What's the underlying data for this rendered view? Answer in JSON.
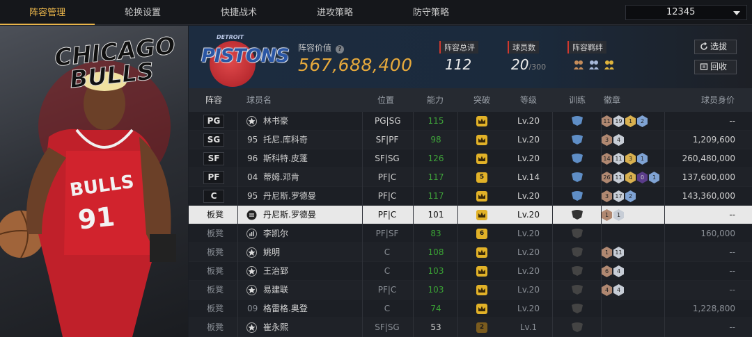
{
  "tabs": [
    {
      "label": "阵容管理",
      "active": true
    },
    {
      "label": "轮换设置",
      "active": false
    },
    {
      "label": "快捷战术",
      "active": false
    },
    {
      "label": "进攻策略",
      "active": false
    },
    {
      "label": "防守策略",
      "active": false
    }
  ],
  "account": {
    "value": "12345"
  },
  "hero": {
    "team_text_1": "CHICAGO",
    "team_text_2": "BULLS",
    "jersey_text": "BULLS",
    "jersey_number": "91"
  },
  "team": {
    "logo_text": "PISTONS",
    "logo_subtext": "DETROIT"
  },
  "stats": {
    "lineup_value_label": "阵容价值",
    "lineup_value": "567,688,400",
    "rating_label": "阵容总评",
    "rating": "112",
    "players_label": "球员数",
    "players": "20",
    "players_max": "/300",
    "chemistry_label": "阵容羁绊"
  },
  "buttons": {
    "select_label": "选拔",
    "recycle_label": "回收"
  },
  "columns": {
    "lineup": "阵容",
    "name": "球员名",
    "position": "位置",
    "ability": "能力",
    "breakthrough": "突破",
    "level": "等级",
    "training": "训练",
    "badges": "徽章",
    "value": "球员身价"
  },
  "bench_label": "板凳",
  "rows": [
    {
      "slot": "PG",
      "icon": "star",
      "num": "",
      "name": "林书豪",
      "pos": "PG|SG",
      "ability": "115",
      "break": "",
      "level": "Lv.20",
      "badges": [
        [
          "b-br",
          "11"
        ],
        [
          "b-si",
          "19"
        ],
        [
          "b-go",
          "1"
        ],
        [
          "b-bl",
          "2"
        ]
      ],
      "value": "--"
    },
    {
      "slot": "SG",
      "icon": "",
      "num": "95",
      "name": "托尼.库科奇",
      "pos": "SF|PF",
      "ability": "98",
      "break": "",
      "level": "Lv.20",
      "badges": [
        [
          "b-br",
          "3"
        ],
        [
          "b-si",
          "4"
        ]
      ],
      "value": "1,209,600"
    },
    {
      "slot": "SF",
      "icon": "",
      "num": "96",
      "name": "斯科特.皮蓬",
      "pos": "SF|SG",
      "ability": "126",
      "break": "",
      "level": "Lv.20",
      "badges": [
        [
          "b-br",
          "14"
        ],
        [
          "b-si",
          "11"
        ],
        [
          "b-go",
          "3"
        ],
        [
          "b-bl",
          "1"
        ]
      ],
      "value": "260,480,000"
    },
    {
      "slot": "PF",
      "icon": "",
      "num": "04",
      "name": "蒂姆.邓肯",
      "pos": "PF|C",
      "ability": "117",
      "break": "5",
      "level": "Lv.14",
      "badges": [
        [
          "b-br",
          "26"
        ],
        [
          "b-si",
          "11"
        ],
        [
          "b-go",
          "4"
        ],
        [
          "b-pu",
          "0"
        ],
        [
          "b-bl",
          "1"
        ]
      ],
      "value": "137,600,000"
    },
    {
      "slot": "C",
      "icon": "",
      "num": "95",
      "name": "丹尼斯.罗德曼",
      "pos": "PF|C",
      "ability": "117",
      "break": "",
      "level": "Lv.20",
      "badges": [
        [
          "b-br",
          "3"
        ],
        [
          "b-si",
          "17"
        ],
        [
          "b-bl",
          "2"
        ]
      ],
      "value": "143,360,000"
    },
    {
      "slot": "板凳",
      "icon": "copy",
      "num": "",
      "name": "丹尼斯.罗德曼",
      "pos": "PF|C",
      "ability": "101",
      "break": "",
      "level": "Lv.20",
      "badges": [
        [
          "b-br",
          "1"
        ],
        [
          "b-si",
          "1"
        ]
      ],
      "value": "--"
    },
    {
      "slot": "板凳",
      "icon": "bars",
      "num": "",
      "name": "李凯尔",
      "pos": "PF|SF",
      "ability": "83",
      "break": "6",
      "level": "Lv.20",
      "badges": [],
      "value": "160,000"
    },
    {
      "slot": "板凳",
      "icon": "star",
      "num": "",
      "name": "姚明",
      "pos": "C",
      "ability": "108",
      "break": "",
      "level": "Lv.20",
      "badges": [
        [
          "b-br",
          "1"
        ],
        [
          "b-si",
          "11"
        ]
      ],
      "value": "--"
    },
    {
      "slot": "板凳",
      "icon": "star",
      "num": "",
      "name": "王治郅",
      "pos": "C",
      "ability": "103",
      "break": "",
      "level": "Lv.20",
      "badges": [
        [
          "b-br",
          "6"
        ],
        [
          "b-si",
          "4"
        ]
      ],
      "value": "--"
    },
    {
      "slot": "板凳",
      "icon": "star",
      "num": "",
      "name": "易建联",
      "pos": "PF|C",
      "ability": "103",
      "break": "",
      "level": "Lv.20",
      "badges": [
        [
          "b-br",
          "4"
        ],
        [
          "b-si",
          "4"
        ]
      ],
      "value": "--"
    },
    {
      "slot": "板凳",
      "icon": "",
      "num": "09",
      "name": "格雷格.奥登",
      "pos": "C",
      "ability": "74",
      "break": "",
      "level": "Lv.20",
      "badges": [],
      "value": "1,228,800"
    },
    {
      "slot": "板凳",
      "icon": "star",
      "num": "",
      "name": "崔永熙",
      "pos": "SF|SG",
      "ability": "53",
      "break": "2",
      "level": "Lv.1",
      "badges": [],
      "value": "--"
    }
  ]
}
